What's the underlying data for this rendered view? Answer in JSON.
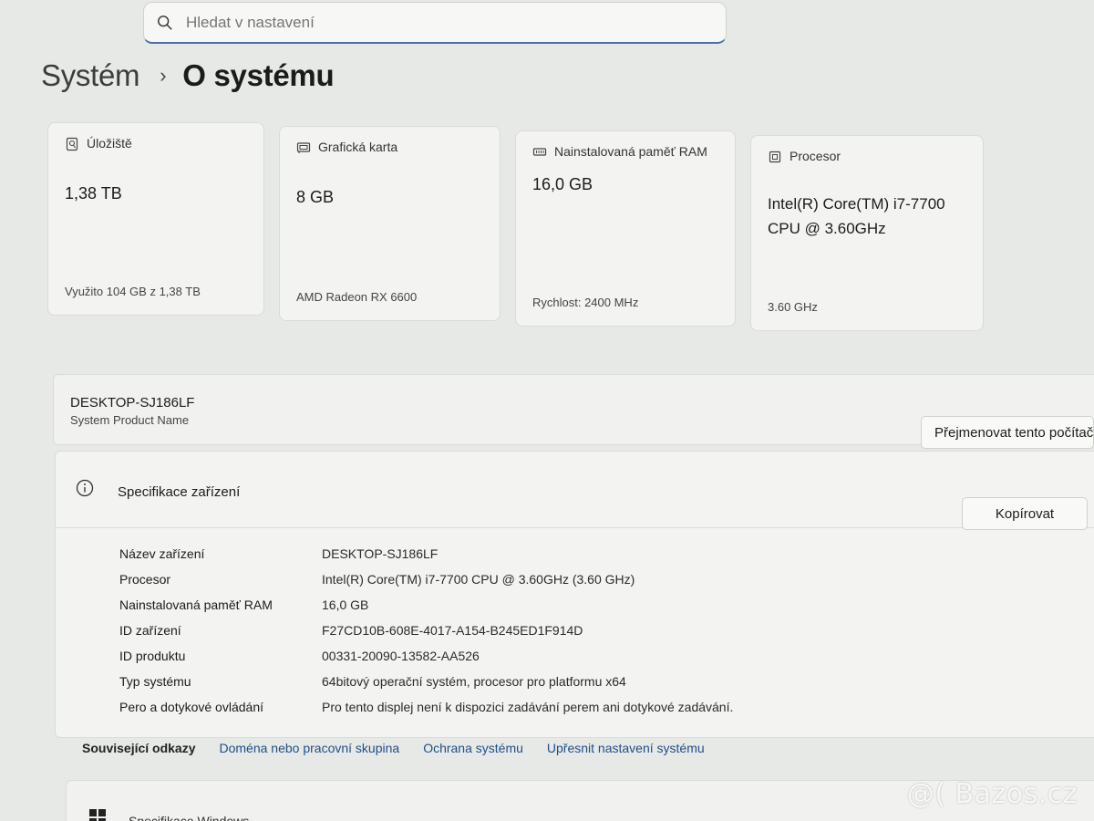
{
  "search": {
    "placeholder": "Hledat v nastavení"
  },
  "breadcrumb": {
    "root": "Systém",
    "current": "O systému"
  },
  "cards": {
    "storage": {
      "icon": "storage-icon",
      "label": "Úložiště",
      "value": "1,38 TB",
      "footer": "Využito 104 GB z 1,38 TB"
    },
    "gpu": {
      "icon": "graphics-card-icon",
      "label": "Grafická karta",
      "value": "8 GB",
      "footer": "AMD Radeon RX 6600"
    },
    "ram": {
      "icon": "memory-icon",
      "label": "Nainstalovaná paměť RAM",
      "value": "16,0 GB",
      "footer": "Rychlost: 2400 MHz"
    },
    "cpu": {
      "icon": "processor-icon",
      "label": "Procesor",
      "value": "Intel(R) Core(TM) i7-7700 CPU @ 3.60GHz",
      "footer": "3.60 GHz"
    }
  },
  "device": {
    "name": "DESKTOP-SJ186LF",
    "subtitle": "System Product Name",
    "rename_label": "Přejmenovat tento počítač"
  },
  "spec": {
    "title": "Specifikace zařízení",
    "copy_label": "Kopírovat",
    "rows": [
      {
        "key": "Název zařízení",
        "value": "DESKTOP-SJ186LF"
      },
      {
        "key": "Procesor",
        "value": "Intel(R) Core(TM) i7-7700 CPU @ 3.60GHz (3.60 GHz)"
      },
      {
        "key": "Nainstalovaná paměť RAM",
        "value": "16,0 GB"
      },
      {
        "key": "ID zařízení",
        "value": "F27CD10B-608E-4017-A154-B245ED1F914D"
      },
      {
        "key": "ID produktu",
        "value": "00331-20090-13582-AA526"
      },
      {
        "key": "Typ systému",
        "value": "64bitový operační systém, procesor pro platformu x64"
      },
      {
        "key": "Pero a dotykové ovládání",
        "value": "Pro tento displej není k dispozici zadávání perem ani dotykové zadávání."
      }
    ]
  },
  "related": {
    "label": "Související odkazy",
    "links": [
      "Doména nebo pracovní skupina",
      "Ochrana systému",
      "Upřesnit nastavení systému"
    ]
  },
  "windows_spec": {
    "title": "Specifikace Windows"
  },
  "watermark": "@( Bazos.cz",
  "colors": {
    "accent": "#4a6fa5",
    "link": "#1f4f8a",
    "background": "#e6e9e5",
    "card": "#f3f4f2"
  }
}
